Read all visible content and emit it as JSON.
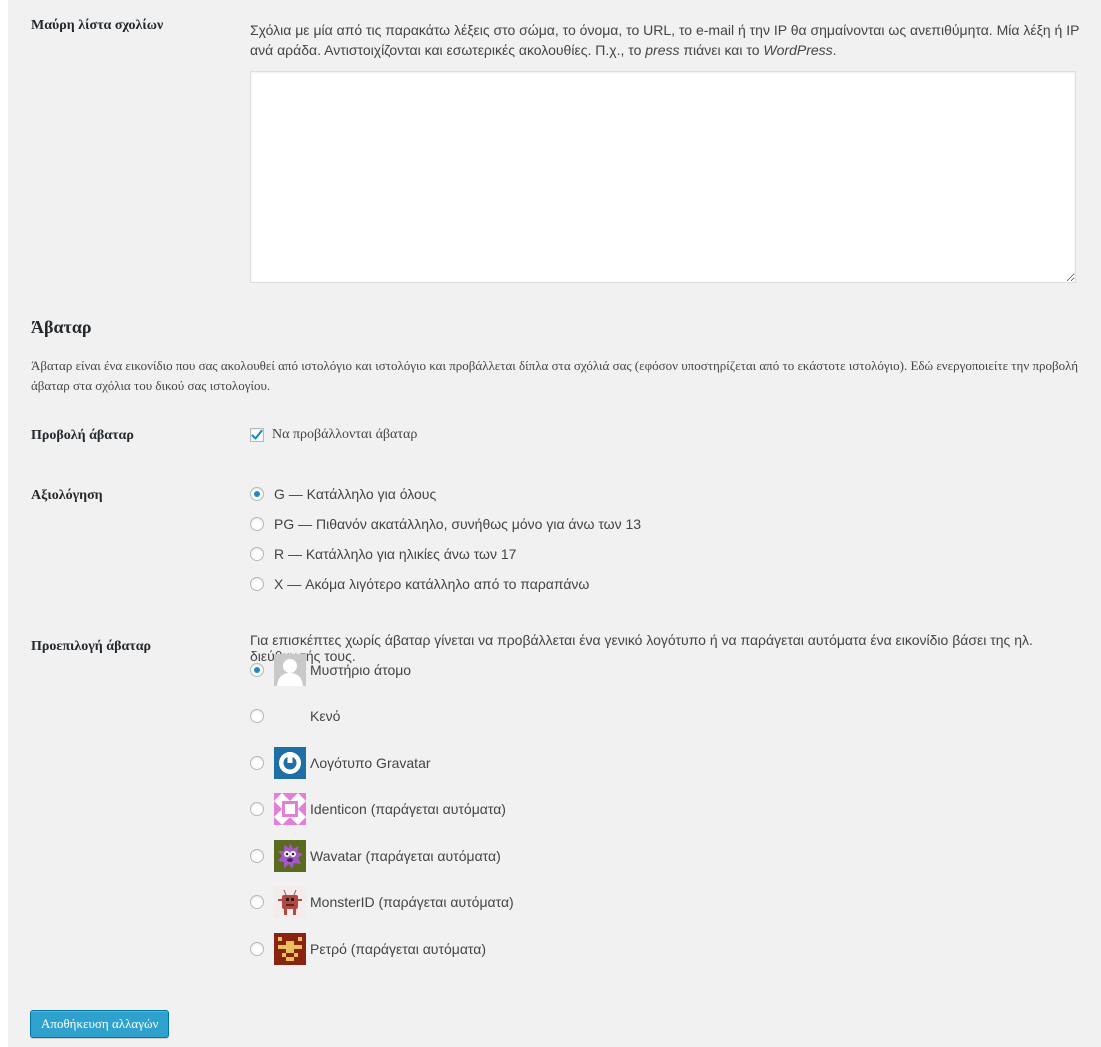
{
  "blacklist": {
    "label": "Μαύρη λίστα σχολίων",
    "description_part1": "Σχόλια με μία από τις παρακάτω λέξεις στο σώμα, το όνομα, το URL, το e-mail ή την IP θα σημαίνονται ως ανεπιθύμητα. Μία λέξη ή IP ανά αράδα. Αντιστοιχίζονται και εσωτερικές ακολουθίες. Π.χ., το ",
    "description_em1": "press",
    "description_part2": " πιάνει και το ",
    "description_em2": "WordPress",
    "description_part3": ".",
    "value": ""
  },
  "avatars_section": {
    "title": "Άβαταρ",
    "description": "Άβαταρ είναι ένα εικονίδιο που σας ακολουθεί από ιστολόγιο και ιστολόγιο και προβάλλεται δίπλα στα σχόλιά σας (εφόσον υποστηρίζεται από το εκάστοτε ιστολόγιο). Εδώ ενεργοποιείτε την προβολή άβαταρ στα σχόλια του δικού σας ιστολογίου."
  },
  "show_avatars": {
    "label": "Προβολή άβαταρ",
    "checkbox_label": "Να προβάλλονται άβαταρ",
    "checked": true
  },
  "rating": {
    "label": "Αξιολόγηση",
    "options": [
      {
        "label": "G — Κατάλληλο για όλους",
        "selected": true
      },
      {
        "label": "PG — Πιθανόν ακατάλληλο, συνήθως μόνο για άνω των 13",
        "selected": false
      },
      {
        "label": "R — Κατάλληλο για ηλικίες άνω των 17",
        "selected": false
      },
      {
        "label": "X — Ακόμα λιγότερο κατάλληλο από το παραπάνω",
        "selected": false
      }
    ]
  },
  "default_avatar": {
    "label": "Προεπιλογή άβαταρ",
    "description": "Για επισκέπτες χωρίς άβαταρ γίνεται να προβάλλεται ένα γενικό λογότυπο ή να παράγεται αυτόματα ένα εικονίδιο βάσει της ηλ. διεύθυνσής τους.",
    "options": [
      {
        "label": "Μυστήριο άτομο",
        "icon": "mystery-person-icon",
        "selected": true
      },
      {
        "label": "Κενό",
        "icon": "blank-icon",
        "selected": false
      },
      {
        "label": "Λογότυπο Gravatar",
        "icon": "gravatar-logo-icon",
        "selected": false
      },
      {
        "label": "Identicon (παράγεται αυτόματα)",
        "icon": "identicon-icon",
        "selected": false
      },
      {
        "label": "Wavatar (παράγεται αυτόματα)",
        "icon": "wavatar-icon",
        "selected": false
      },
      {
        "label": "MonsterID (παράγεται αυτόματα)",
        "icon": "monsterid-icon",
        "selected": false
      },
      {
        "label": "Ρετρό (παράγεται αυτόματα)",
        "icon": "retro-icon",
        "selected": false
      }
    ]
  },
  "save_button": {
    "label": "Αποθήκευση αλλαγών"
  },
  "colors": {
    "background": "#f1f1f1",
    "accent": "#2ea2cc",
    "radio_dot": "#1e8cbe",
    "gravatar_blue": "#1e6ea7"
  }
}
